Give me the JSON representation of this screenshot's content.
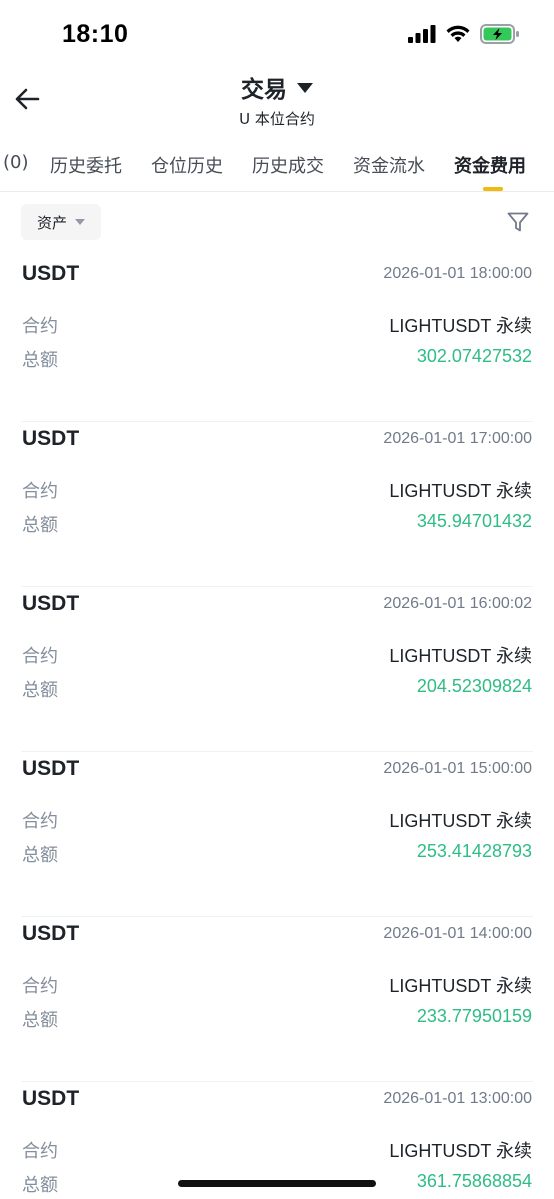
{
  "status_bar": {
    "time": "18:10"
  },
  "header": {
    "title": "交易",
    "subtitle": "U 本位合约"
  },
  "tabs": [
    {
      "label": "(0)",
      "active": false
    },
    {
      "label": "历史委托",
      "active": false
    },
    {
      "label": "仓位历史",
      "active": false
    },
    {
      "label": "历史成交",
      "active": false
    },
    {
      "label": "资金流水",
      "active": false
    },
    {
      "label": "资金费用",
      "active": true
    }
  ],
  "filter": {
    "asset_label": "资产"
  },
  "labels": {
    "contract": "合约",
    "amount": "总额"
  },
  "accent_color": "#f0b90b",
  "positive_color": "#2ebd85",
  "records": [
    {
      "asset": "USDT",
      "time": "2026-01-01 18:00:00",
      "contract": "LIGHTUSDT 永续",
      "amount": "302.07427532"
    },
    {
      "asset": "USDT",
      "time": "2026-01-01 17:00:00",
      "contract": "LIGHTUSDT 永续",
      "amount": "345.94701432"
    },
    {
      "asset": "USDT",
      "time": "2026-01-01 16:00:02",
      "contract": "LIGHTUSDT 永续",
      "amount": "204.52309824"
    },
    {
      "asset": "USDT",
      "time": "2026-01-01 15:00:00",
      "contract": "LIGHTUSDT 永续",
      "amount": "253.41428793"
    },
    {
      "asset": "USDT",
      "time": "2026-01-01 14:00:00",
      "contract": "LIGHTUSDT 永续",
      "amount": "233.77950159"
    },
    {
      "asset": "USDT",
      "time": "2026-01-01 13:00:00",
      "contract": "LIGHTUSDT 永续",
      "amount": "361.75868854"
    }
  ]
}
